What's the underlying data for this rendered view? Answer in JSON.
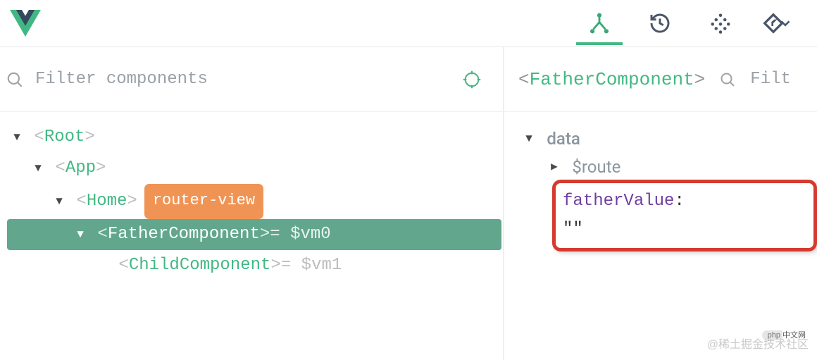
{
  "topbar": {
    "tabs": [
      "components",
      "history",
      "vuex",
      "routing"
    ],
    "activeTab": 0
  },
  "filter": {
    "placeholder": "Filter components"
  },
  "tree": {
    "rows": [
      {
        "name": "Root",
        "open": "<",
        "close": ">"
      },
      {
        "name": "App",
        "open": "<",
        "close": ">"
      },
      {
        "name": "Home",
        "open": "<",
        "close": ">",
        "badge": "router-view"
      },
      {
        "name": "FatherComponent",
        "open": "<",
        "close": ">",
        "suffix": " = $vm0"
      },
      {
        "name": "ChildComponent",
        "open": "<",
        "close": ">",
        "suffix": " = $vm1"
      }
    ]
  },
  "inspector": {
    "title_open": "<",
    "title_name": "FatherComponent",
    "title_close": ">",
    "filter_placeholder": "Filt",
    "section": "data",
    "items": {
      "route": "$route",
      "fatherValue_key": "fatherValue",
      "fatherValue_colon": ": ",
      "fatherValue_val": "\"\""
    }
  },
  "watermark": {
    "php": "php",
    "cn": "中文网",
    "text": "@稀土掘金技术社区"
  }
}
